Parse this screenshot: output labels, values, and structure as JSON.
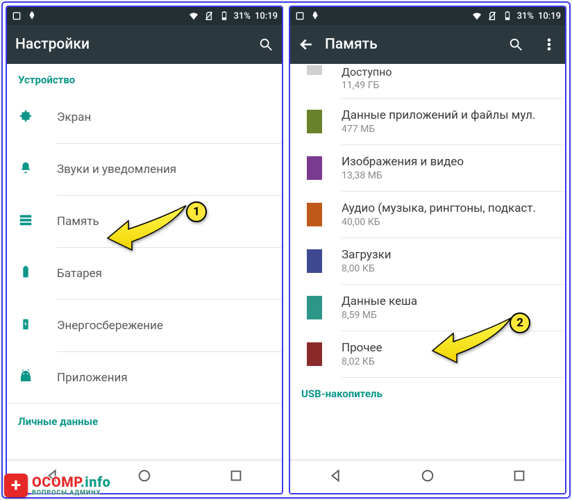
{
  "status": {
    "battery_pct": "31%",
    "time": "10:19"
  },
  "left": {
    "title": "Настройки",
    "section_device": "Устройство",
    "items": [
      {
        "label": "Экран"
      },
      {
        "label": "Звуки и уведомления"
      },
      {
        "label": "Память"
      },
      {
        "label": "Батарея"
      },
      {
        "label": "Энергосбережение"
      },
      {
        "label": "Приложения"
      }
    ],
    "section_personal": "Личные данные"
  },
  "right": {
    "title": "Память",
    "available": {
      "title": "Доступно",
      "sub": "11,49 ГБ"
    },
    "categories": [
      {
        "title": "Данные приложений и файлы мул.",
        "sub": "477 МБ",
        "color": "#6a822b"
      },
      {
        "title": "Изображения и видео",
        "sub": "13,38 МБ",
        "color": "#7a3a8f"
      },
      {
        "title": "Аудио (музыка, рингтоны, подкаст.",
        "sub": "40,00 КБ",
        "color": "#bf5a1a"
      },
      {
        "title": "Загрузки",
        "sub": "8,00 КБ",
        "color": "#3e4a8f"
      },
      {
        "title": "Данные кеша",
        "sub": "8,59 МБ",
        "color": "#2e9688"
      },
      {
        "title": "Прочее",
        "sub": "8,02 КБ",
        "color": "#8b2a2a"
      }
    ],
    "usb_label": "USB-накопитель"
  },
  "callouts": {
    "one": "1",
    "two": "2"
  },
  "watermark": {
    "brand": "OCOMP",
    "tld": ".info",
    "sub": "ВОПРОСЫ АДМИНУ"
  }
}
